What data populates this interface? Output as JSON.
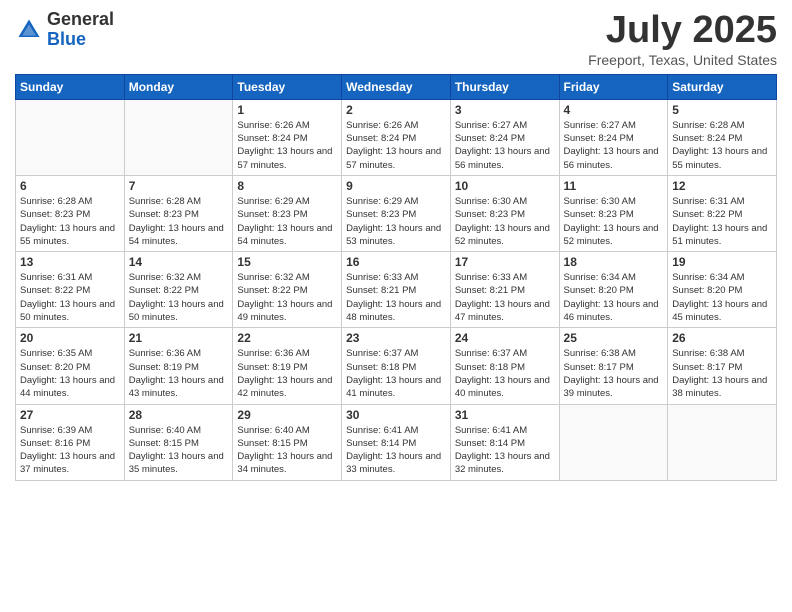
{
  "header": {
    "logo_general": "General",
    "logo_blue": "Blue",
    "month_year": "July 2025",
    "location": "Freeport, Texas, United States"
  },
  "weekdays": [
    "Sunday",
    "Monday",
    "Tuesday",
    "Wednesday",
    "Thursday",
    "Friday",
    "Saturday"
  ],
  "weeks": [
    [
      {
        "day": "",
        "info": ""
      },
      {
        "day": "",
        "info": ""
      },
      {
        "day": "1",
        "info": "Sunrise: 6:26 AM\nSunset: 8:24 PM\nDaylight: 13 hours and 57 minutes."
      },
      {
        "day": "2",
        "info": "Sunrise: 6:26 AM\nSunset: 8:24 PM\nDaylight: 13 hours and 57 minutes."
      },
      {
        "day": "3",
        "info": "Sunrise: 6:27 AM\nSunset: 8:24 PM\nDaylight: 13 hours and 56 minutes."
      },
      {
        "day": "4",
        "info": "Sunrise: 6:27 AM\nSunset: 8:24 PM\nDaylight: 13 hours and 56 minutes."
      },
      {
        "day": "5",
        "info": "Sunrise: 6:28 AM\nSunset: 8:24 PM\nDaylight: 13 hours and 55 minutes."
      }
    ],
    [
      {
        "day": "6",
        "info": "Sunrise: 6:28 AM\nSunset: 8:23 PM\nDaylight: 13 hours and 55 minutes."
      },
      {
        "day": "7",
        "info": "Sunrise: 6:28 AM\nSunset: 8:23 PM\nDaylight: 13 hours and 54 minutes."
      },
      {
        "day": "8",
        "info": "Sunrise: 6:29 AM\nSunset: 8:23 PM\nDaylight: 13 hours and 54 minutes."
      },
      {
        "day": "9",
        "info": "Sunrise: 6:29 AM\nSunset: 8:23 PM\nDaylight: 13 hours and 53 minutes."
      },
      {
        "day": "10",
        "info": "Sunrise: 6:30 AM\nSunset: 8:23 PM\nDaylight: 13 hours and 52 minutes."
      },
      {
        "day": "11",
        "info": "Sunrise: 6:30 AM\nSunset: 8:23 PM\nDaylight: 13 hours and 52 minutes."
      },
      {
        "day": "12",
        "info": "Sunrise: 6:31 AM\nSunset: 8:22 PM\nDaylight: 13 hours and 51 minutes."
      }
    ],
    [
      {
        "day": "13",
        "info": "Sunrise: 6:31 AM\nSunset: 8:22 PM\nDaylight: 13 hours and 50 minutes."
      },
      {
        "day": "14",
        "info": "Sunrise: 6:32 AM\nSunset: 8:22 PM\nDaylight: 13 hours and 50 minutes."
      },
      {
        "day": "15",
        "info": "Sunrise: 6:32 AM\nSunset: 8:22 PM\nDaylight: 13 hours and 49 minutes."
      },
      {
        "day": "16",
        "info": "Sunrise: 6:33 AM\nSunset: 8:21 PM\nDaylight: 13 hours and 48 minutes."
      },
      {
        "day": "17",
        "info": "Sunrise: 6:33 AM\nSunset: 8:21 PM\nDaylight: 13 hours and 47 minutes."
      },
      {
        "day": "18",
        "info": "Sunrise: 6:34 AM\nSunset: 8:20 PM\nDaylight: 13 hours and 46 minutes."
      },
      {
        "day": "19",
        "info": "Sunrise: 6:34 AM\nSunset: 8:20 PM\nDaylight: 13 hours and 45 minutes."
      }
    ],
    [
      {
        "day": "20",
        "info": "Sunrise: 6:35 AM\nSunset: 8:20 PM\nDaylight: 13 hours and 44 minutes."
      },
      {
        "day": "21",
        "info": "Sunrise: 6:36 AM\nSunset: 8:19 PM\nDaylight: 13 hours and 43 minutes."
      },
      {
        "day": "22",
        "info": "Sunrise: 6:36 AM\nSunset: 8:19 PM\nDaylight: 13 hours and 42 minutes."
      },
      {
        "day": "23",
        "info": "Sunrise: 6:37 AM\nSunset: 8:18 PM\nDaylight: 13 hours and 41 minutes."
      },
      {
        "day": "24",
        "info": "Sunrise: 6:37 AM\nSunset: 8:18 PM\nDaylight: 13 hours and 40 minutes."
      },
      {
        "day": "25",
        "info": "Sunrise: 6:38 AM\nSunset: 8:17 PM\nDaylight: 13 hours and 39 minutes."
      },
      {
        "day": "26",
        "info": "Sunrise: 6:38 AM\nSunset: 8:17 PM\nDaylight: 13 hours and 38 minutes."
      }
    ],
    [
      {
        "day": "27",
        "info": "Sunrise: 6:39 AM\nSunset: 8:16 PM\nDaylight: 13 hours and 37 minutes."
      },
      {
        "day": "28",
        "info": "Sunrise: 6:40 AM\nSunset: 8:15 PM\nDaylight: 13 hours and 35 minutes."
      },
      {
        "day": "29",
        "info": "Sunrise: 6:40 AM\nSunset: 8:15 PM\nDaylight: 13 hours and 34 minutes."
      },
      {
        "day": "30",
        "info": "Sunrise: 6:41 AM\nSunset: 8:14 PM\nDaylight: 13 hours and 33 minutes."
      },
      {
        "day": "31",
        "info": "Sunrise: 6:41 AM\nSunset: 8:14 PM\nDaylight: 13 hours and 32 minutes."
      },
      {
        "day": "",
        "info": ""
      },
      {
        "day": "",
        "info": ""
      }
    ]
  ]
}
